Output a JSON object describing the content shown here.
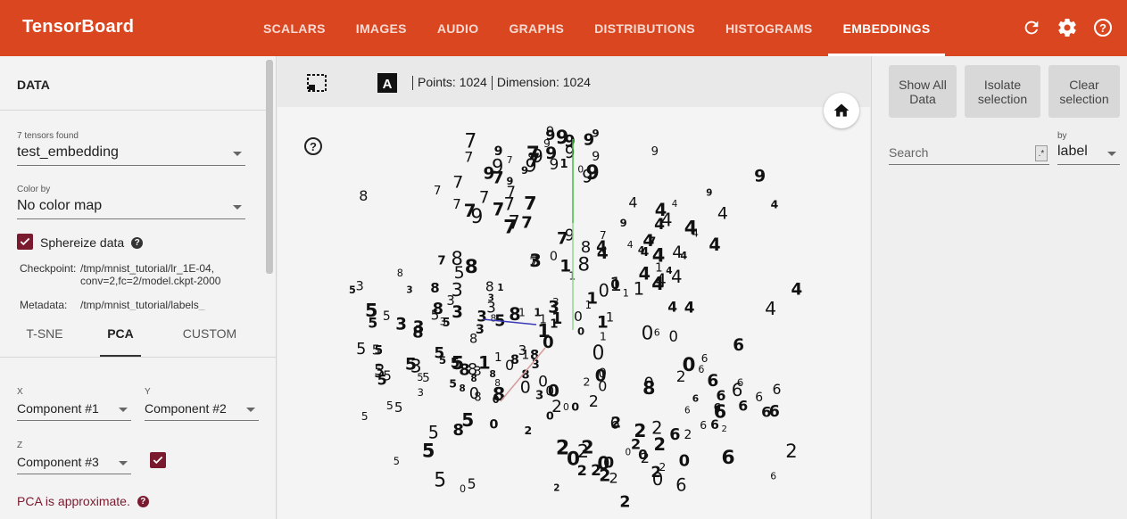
{
  "app": {
    "title": "TensorBoard"
  },
  "nav": {
    "tabs": [
      "SCALARS",
      "IMAGES",
      "AUDIO",
      "GRAPHS",
      "DISTRIBUTIONS",
      "HISTOGRAMS",
      "EMBEDDINGS"
    ],
    "active_tab": "EMBEDDINGS"
  },
  "left": {
    "data_title": "DATA",
    "tensors_found": "7 tensors found",
    "tensor_value": "test_embedding",
    "color_by_label": "Color by",
    "color_by_value": "No color map",
    "sphereize_label": "Sphereize data",
    "checkpoint_key": "Checkpoint:",
    "checkpoint_val": "/tmp/mnist_tutorial/lr_1E-04, conv=2,fc=2/model.ckpt-2000",
    "metadata_key": "Metadata:",
    "metadata_val": "/tmp/mnist_tutorial/labels_",
    "proj_tabs": [
      "T-SNE",
      "PCA",
      "CUSTOM"
    ],
    "x_label": "X",
    "x_value": "Component #1",
    "y_label": "Y",
    "y_value": "Component #2",
    "z_label": "Z",
    "z_value": "Component #3",
    "pca_note": "PCA is approximate."
  },
  "center": {
    "points_text": "Points: 1024",
    "dimension_text": "Dimension: 1024"
  },
  "right": {
    "show_all": "Show All Data",
    "isolate": "Isolate selection",
    "clear": "Clear selection",
    "search_placeholder": "Search",
    "regex": ".*",
    "by_label": "by",
    "by_value": "label"
  },
  "colors": {
    "brand": "#d9461f",
    "accent": "#7a1a2e"
  },
  "icons": [
    "refresh-icon",
    "settings-icon",
    "help-icon",
    "select-region-icon",
    "night-mode-icon",
    "label-toggle-icon",
    "home-icon"
  ]
}
